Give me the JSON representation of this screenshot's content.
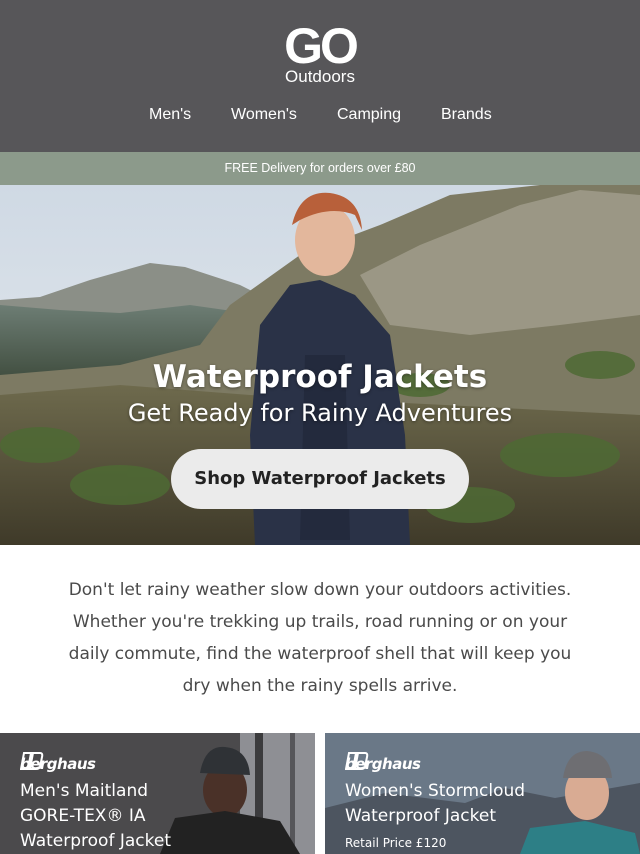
{
  "header": {
    "logo_main": "GO",
    "logo_sub": "Outdoors",
    "nav": [
      "Men's",
      "Women's",
      "Camping",
      "Brands"
    ]
  },
  "banner": {
    "text": "FREE Delivery for orders over £80"
  },
  "hero": {
    "title": "Waterproof Jackets",
    "subtitle": "Get Ready for Rainy Adventures",
    "button": "Shop Waterproof Jackets"
  },
  "intro": {
    "text": "Don't let rainy weather slow down your outdoors activities. Whether you're trekking up trails, road running or on your daily commute, find the waterproof shell that will keep you dry when the rainy spells arrive."
  },
  "products": [
    {
      "brand": "berghaus",
      "title_lines": [
        "Men's Maitland",
        "GORE-TEX® IA",
        "Waterproof Jacket"
      ]
    },
    {
      "brand": "berghaus",
      "title_lines": [
        "Women's Stormcloud",
        "Waterproof Jacket"
      ],
      "price": "Retail Price £120"
    }
  ],
  "colors": {
    "header_bg": "#575659",
    "banner_bg": "#8c9a8b",
    "button_bg": "#ebebeb",
    "body_text": "#4a4a4a"
  }
}
